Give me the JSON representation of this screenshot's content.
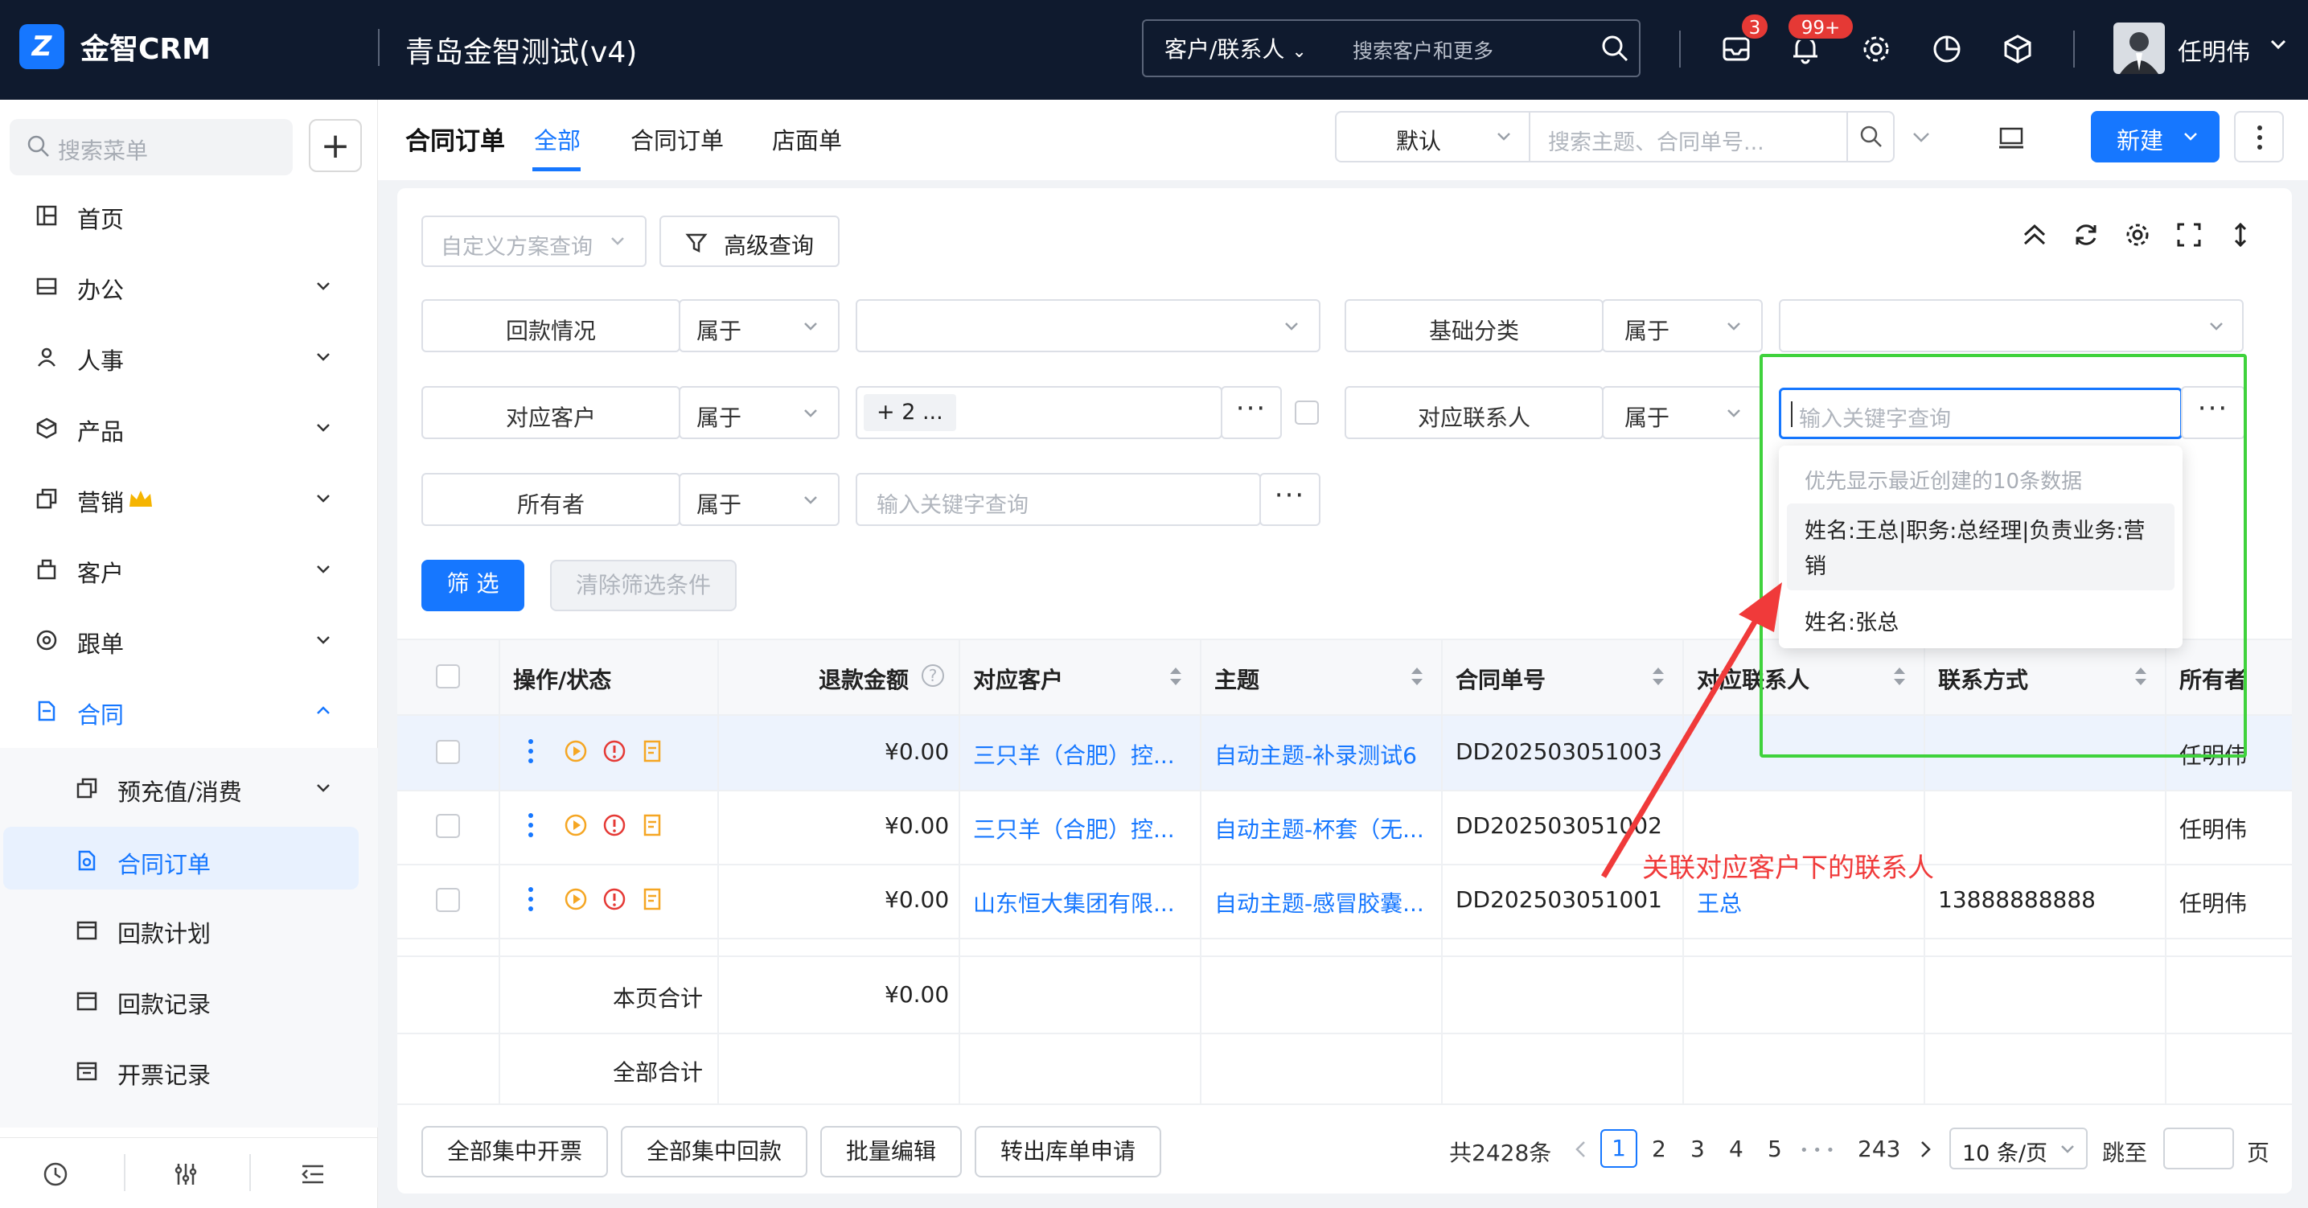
{
  "topbar": {
    "app_name": "金智CRM",
    "company": "青岛金智测试(v4)",
    "search_scope": "客户/联系人",
    "search_placeholder": "搜索客户和更多",
    "msg_count": "3",
    "notify_count": "99+",
    "user_name": "任明伟"
  },
  "sidebar": {
    "search_placeholder": "搜索菜单",
    "items": [
      {
        "label": "首页",
        "icon": "layout-icon"
      },
      {
        "label": "办公",
        "icon": "inbox-icon"
      },
      {
        "label": "人事",
        "icon": "person-icon"
      },
      {
        "label": "产品",
        "icon": "box-icon"
      },
      {
        "label": "营销",
        "icon": "copy-icon"
      },
      {
        "label": "客户",
        "icon": "building-icon"
      },
      {
        "label": "跟单",
        "icon": "target-icon"
      },
      {
        "label": "合同",
        "icon": "contract-icon"
      }
    ],
    "subitems": [
      {
        "label": "预充值/消费"
      },
      {
        "label": "合同订单"
      },
      {
        "label": "回款计划"
      },
      {
        "label": "回款记录"
      },
      {
        "label": "开票记录"
      }
    ]
  },
  "header": {
    "title": "合同订单",
    "tabs": [
      "全部",
      "合同订单",
      "店面单"
    ],
    "view_select": "默认",
    "search_placeholder": "搜索主题、合同单号...",
    "new_label": "新建"
  },
  "filters": {
    "scheme_placeholder": "自定义方案查询",
    "advanced_label": "高级查询",
    "rows": [
      {
        "field": "回款情况",
        "op": "属于",
        "value": ""
      },
      {
        "field": "基础分类",
        "op": "属于",
        "value": ""
      },
      {
        "field": "对应客户",
        "op": "属于",
        "value": "+ 2 ..."
      },
      {
        "field": "对应联系人",
        "op": "属于",
        "value": ""
      },
      {
        "field": "所有者",
        "op": "属于",
        "value": ""
      }
    ],
    "keyword_placeholder": "输入关键字查询",
    "filter_btn": "筛 选",
    "clear_btn": "清除筛选条件"
  },
  "dropdown": {
    "hint": "优先显示最近创建的10条数据",
    "options": [
      "姓名:王总|职务:总经理|负责业务:营",
      "销",
      "姓名:张总"
    ]
  },
  "annotation": "关联对应客户下的联系人",
  "table": {
    "columns": [
      "操作/状态",
      "退款金额",
      "对应客户",
      "主题",
      "合同单号",
      "对应联系人",
      "联系方式",
      "所有者"
    ],
    "rows": [
      {
        "amount": "¥0.00",
        "customer": "三只羊（合肥）控...",
        "subject": "自动主题-补录测试6",
        "no": "DD202503051003",
        "contact": "",
        "phone": "",
        "owner": "任明伟"
      },
      {
        "amount": "¥0.00",
        "customer": "三只羊（合肥）控...",
        "subject": "自动主题-杯套（无...",
        "no": "DD202503051002",
        "contact": "",
        "phone": "",
        "owner": "任明伟"
      },
      {
        "amount": "¥0.00",
        "customer": "山东恒大集团有限...",
        "subject": "自动主题-感冒胶囊...",
        "no": "DD202503051001",
        "contact": "王总",
        "phone": "13888888888",
        "owner": "任明伟"
      }
    ],
    "page_total_label": "本页合计",
    "page_total": "¥0.00",
    "all_total_label": "全部合计"
  },
  "footer": {
    "buttons": [
      "全部集中开票",
      "全部集中回款",
      "批量编辑",
      "转出库单申请"
    ],
    "total": "共2428条",
    "pages": [
      "1",
      "2",
      "3",
      "4",
      "5",
      "• • •",
      "243"
    ],
    "page_size": "10 条/页",
    "jump_label": "跳至",
    "page_unit": "页"
  },
  "colors": {
    "accent": "#1677ff",
    "topbar": "#0f1a2e",
    "highlight": "#3fd23c",
    "annotation": "#f03a3a"
  }
}
